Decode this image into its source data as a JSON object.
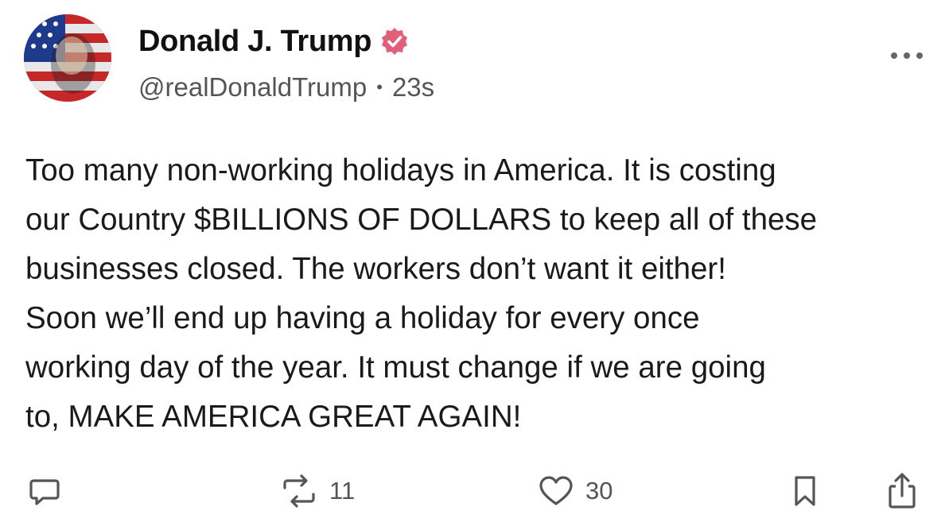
{
  "post": {
    "author": {
      "display_name": "Donald J. Trump",
      "verified": true,
      "handle": "@realDonaldTrump",
      "separator": "•",
      "time": "23s",
      "avatar_icon": "avatar-flag-portrait"
    },
    "more_icon": "more-horizontal-icon",
    "body_lines": [
      "Too many non-working holidays in America. It is costing",
      "our Country $BILLIONS OF DOLLARS to keep all of these",
      "businesses closed. The workers don’t want it either!",
      "Soon we’ll end up having a holiday for every once",
      "working day of the year. It must change if we are going",
      "to, MAKE AMERICA GREAT AGAIN!"
    ],
    "actions": {
      "reply_icon": "reply-icon",
      "repost_icon": "repost-icon",
      "repost_count": "11",
      "like_icon": "heart-icon",
      "like_count": "30",
      "bookmark_icon": "bookmark-icon",
      "share_icon": "share-icon"
    }
  },
  "colors": {
    "verified_badge": "#e0607a",
    "text_primary": "#1a1a1a",
    "text_secondary": "#555555",
    "background": "#ffffff"
  }
}
